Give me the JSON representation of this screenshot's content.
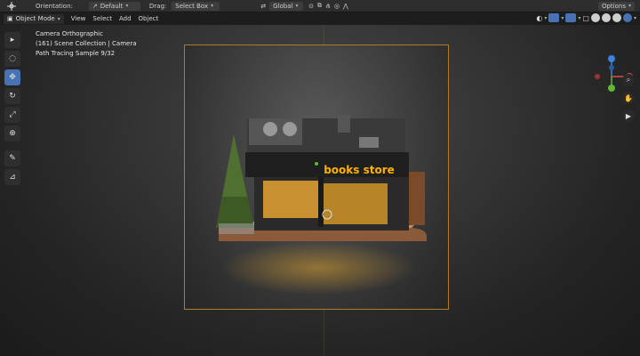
{
  "topbar": {
    "orientation_label": "Orientation:",
    "orientation_value": "Default",
    "drag_label": "Drag:",
    "drag_value": "Select Box",
    "transform_value": "Global",
    "options_label": "Options"
  },
  "header": {
    "mode": "Object Mode",
    "menus": [
      "View",
      "Select",
      "Add",
      "Object"
    ]
  },
  "overlay": {
    "line1": "Camera Orthographic",
    "line2": "(161) Scene Collection | Camera",
    "line3": "Path Tracing Sample 9/32"
  },
  "scene": {
    "sign_text": "books store"
  },
  "colors": {
    "accent": "#4772b3",
    "frame": "#b07a2a",
    "sign": "#ffb000",
    "axis_x": "#e04b4b",
    "axis_y": "#5fb832",
    "axis_z": "#3b82e0"
  },
  "icons": [
    "cursor-icon",
    "circle-select-icon",
    "move-icon",
    "rotate-icon",
    "scale-icon",
    "transform-icon",
    "annotate-icon",
    "measure-icon",
    "zoom-icon",
    "hand-icon",
    "camera-icon"
  ]
}
